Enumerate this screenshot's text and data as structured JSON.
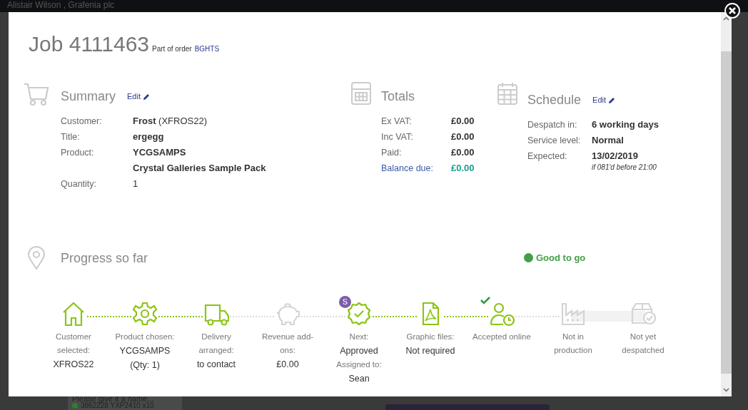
{
  "background": {
    "user": "Alistair Wilson , Grafenia plc",
    "list_heading": "Please give it a name...",
    "list_item": "3862228 YXP2410 x10"
  },
  "modal": {
    "title": "Job 4111463",
    "subtitle": "Part of order",
    "order": "BGHTS"
  },
  "summary": {
    "heading": "Summary",
    "edit": "Edit",
    "rows": [
      {
        "label": "Customer:",
        "value": "**Frost** (XFROS22)"
      },
      {
        "label": "Title:",
        "value": "**ergegg**"
      },
      {
        "label": "Product:",
        "value": "**YCGSAMPS**"
      },
      {
        "label": "",
        "value": "**Crystal Galleries Sample Pack**"
      },
      {
        "label": "Quantity:",
        "value": "1"
      }
    ]
  },
  "totals": {
    "heading": "Totals",
    "rows": [
      {
        "label": "Ex VAT:",
        "value": "£0.00",
        "kind": "plain"
      },
      {
        "label": "Inc VAT:",
        "value": "£0.00",
        "kind": "plain"
      },
      {
        "label": "Paid:",
        "value": "£0.00",
        "kind": "plain"
      },
      {
        "label": "Balance due:",
        "value": "£0.00",
        "kind": "balance"
      }
    ]
  },
  "schedule": {
    "heading": "Schedule",
    "edit": "Edit",
    "rows": [
      {
        "label": "Despatch in:",
        "value": "6 working days"
      },
      {
        "label": "Service level:",
        "value": "Normal"
      },
      {
        "label": "Expected:",
        "value": "13/02/2019",
        "note": "if 081'd before 21:00"
      }
    ]
  },
  "progress": {
    "heading": "Progress so far",
    "status": "Good to go",
    "steps": [
      {
        "kind": "home",
        "done": true,
        "label": "Customer selected:",
        "value": "XFROS22"
      },
      {
        "kind": "gear",
        "done": true,
        "link_done": true,
        "label": "Product chosen:",
        "value": "YCGSAMPS (Qty: 1)"
      },
      {
        "kind": "truck",
        "done": true,
        "link_done": true,
        "label": "Delivery arranged:",
        "value": "to contact"
      },
      {
        "kind": "piggy",
        "done": false,
        "link_done": false,
        "label": "Revenue add-ons:",
        "value": "£0.00"
      },
      {
        "kind": "rosette",
        "done": true,
        "link_done": false,
        "badge": "S",
        "label": "Next:",
        "value": "Approved",
        "extra_label": "Assigned to:",
        "extra_value": "Sean"
      },
      {
        "kind": "pdf",
        "done": true,
        "link_done": true,
        "label": "Graphic files:",
        "value": "Not required"
      },
      {
        "kind": "person-clock",
        "done": true,
        "link_done": true,
        "ticked": true,
        "label": "Accepted online"
      },
      {
        "kind": "factory",
        "done": false,
        "link_done": false,
        "label": "Not in production"
      },
      {
        "kind": "box",
        "done": false,
        "link_done": false,
        "label": "Not yet despatched"
      }
    ]
  }
}
